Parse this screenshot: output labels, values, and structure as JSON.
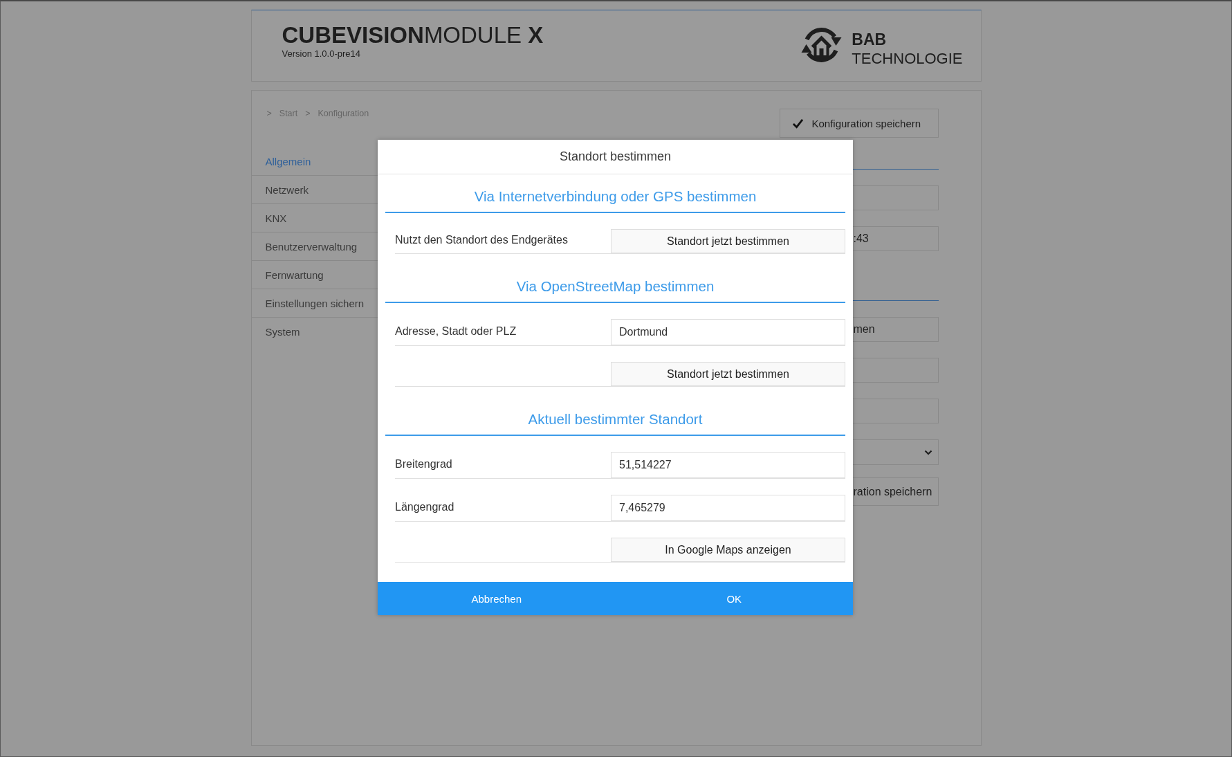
{
  "header": {
    "title": "**CUBEVISION**MODULE **X**",
    "version": "Version 1.0.0-pre14",
    "logo": {
      "line_1": "BAB",
      "line_2": "TECHNOLOGIE"
    }
  },
  "breadcrumb": [
    {
      "separator": ">",
      "label": "Start"
    },
    {
      "separator": ">",
      "label": "Konfiguration"
    }
  ],
  "save_button": {
    "label": "Konfiguration speichern"
  },
  "sidebar": {
    "items": [
      {
        "label": "Allgemein",
        "selected": true
      },
      {
        "label": "Netzwerk",
        "selected": false
      },
      {
        "label": "KNX",
        "selected": false
      },
      {
        "label": "Benutzerverwaltung",
        "selected": false
      },
      {
        "label": "Fernwartung",
        "selected": false
      },
      {
        "label": "Einstellungen sichern",
        "selected": false
      },
      {
        "label": "System",
        "selected": false
      }
    ]
  },
  "background_form": {
    "sections": [
      {
        "fields": [
          {
            "kind": "input"
          },
          {
            "kind": "input",
            "text": ":43"
          }
        ]
      },
      {
        "fields": [
          {
            "kind": "button",
            "text": "men"
          },
          {
            "kind": "input"
          },
          {
            "kind": "input"
          },
          {
            "kind": "select"
          },
          {
            "kind": "button",
            "text": "ration speichern"
          }
        ]
      }
    ]
  },
  "dialog": {
    "title": "Standort bestimmen",
    "sections": [
      {
        "heading": "Via Internetverbindung oder GPS bestimmen",
        "rows": [
          {
            "kind": "button",
            "label": "Nutzt den Standort des Endgerätes",
            "button": "Standort jetzt bestimmen"
          }
        ]
      },
      {
        "heading": "Via OpenStreetMap bestimmen",
        "rows": [
          {
            "kind": "input",
            "label": "Adresse, Stadt oder PLZ",
            "value": "Dortmund"
          },
          {
            "kind": "button",
            "button": "Standort jetzt bestimmen"
          }
        ]
      },
      {
        "heading": "Aktuell bestimmter Standort",
        "rows": [
          {
            "kind": "input",
            "label": "Breitengrad",
            "value": "51,514227"
          },
          {
            "kind": "input",
            "label": "Längengrad",
            "value": "7,465279"
          },
          {
            "kind": "button",
            "button": "In Google Maps anzeigen"
          }
        ]
      }
    ],
    "footer_buttons": [
      "Abbrechen",
      "OK"
    ]
  }
}
